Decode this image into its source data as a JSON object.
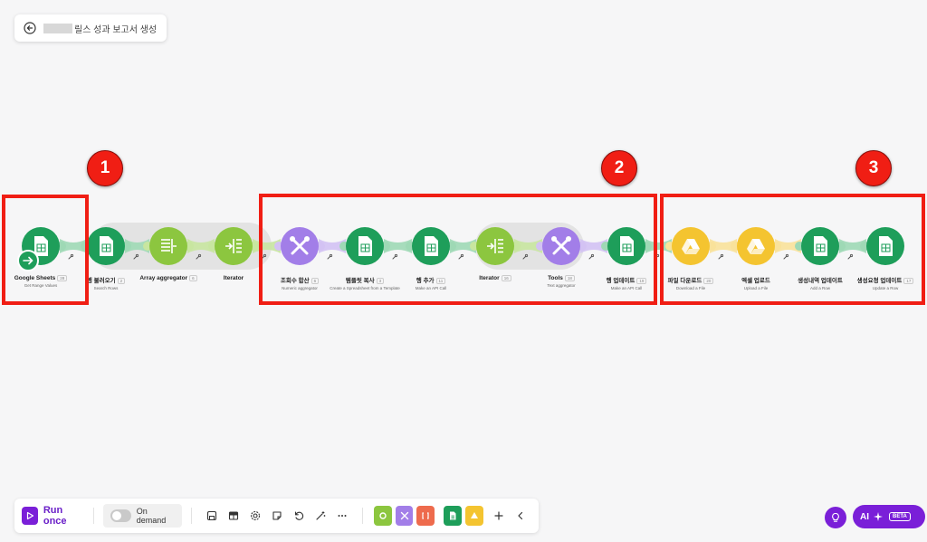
{
  "header": {
    "title": "릴스 성과 보고서 생성"
  },
  "badges": [
    "1",
    "2",
    "3"
  ],
  "nodes": [
    {
      "label": "Google Sheets",
      "id": "28",
      "sub": "Get Range Values",
      "kind": "sheets"
    },
    {
      "label": "행 불러오기",
      "id": "2",
      "sub": "Search Rows",
      "kind": "sheets"
    },
    {
      "label": "Array aggregator",
      "id": "6",
      "sub": "",
      "kind": "aggregator"
    },
    {
      "label": "Iterator",
      "id": "",
      "sub": "",
      "kind": "iterator"
    },
    {
      "label": "조회수 합산",
      "id": "6",
      "sub": "Numeric aggregator",
      "kind": "tools"
    },
    {
      "label": "템플릿 복사",
      "id": "3",
      "sub": "Create a Spreadsheet from a Template",
      "kind": "sheets"
    },
    {
      "label": "행 추가",
      "id": "11",
      "sub": "Make an API Call",
      "kind": "sheets"
    },
    {
      "label": "Iterator",
      "id": "16",
      "sub": "",
      "kind": "iterator"
    },
    {
      "label": "Tools",
      "id": "18",
      "sub": "Text aggregator",
      "kind": "tools"
    },
    {
      "label": "행 업데이트",
      "id": "19",
      "sub": "Make an API Call",
      "kind": "sheets"
    },
    {
      "label": "파일 다운로드",
      "id": "20",
      "sub": "Download a File",
      "kind": "drive"
    },
    {
      "label": "엑셀 업로드",
      "id": "",
      "sub": "Upload a File",
      "kind": "drive"
    },
    {
      "label": "생성내역 업데이트",
      "id": "",
      "sub": "Add a Row",
      "kind": "sheets"
    },
    {
      "label": "생성요청 업데이트",
      "id": "17",
      "sub": "Update a Row",
      "kind": "sheets"
    }
  ],
  "toolbar": {
    "run_label": "Run once",
    "on_demand_label": "On demand",
    "icons": [
      "save-icon",
      "table-icon",
      "settings-icon",
      "notes-icon",
      "undo-icon",
      "magic-wand-icon",
      "more-icon"
    ],
    "shortcuts": [
      "tools-green-shortcut",
      "tools-purple-shortcut",
      "flow-control-shortcut",
      "sheets-shortcut",
      "drive-shortcut"
    ],
    "add_icon": "plus-icon",
    "collapse_icon": "chevron-left-icon"
  },
  "ai": {
    "label": "AI",
    "beta": "BETA"
  },
  "colors": {
    "sheets": "#1e9e5a",
    "aggregator": "#8cc63f",
    "tools": "#a27ee8",
    "drive": "#f4c430",
    "accent": "#7a1fd8",
    "highlight": "#f01e14"
  }
}
